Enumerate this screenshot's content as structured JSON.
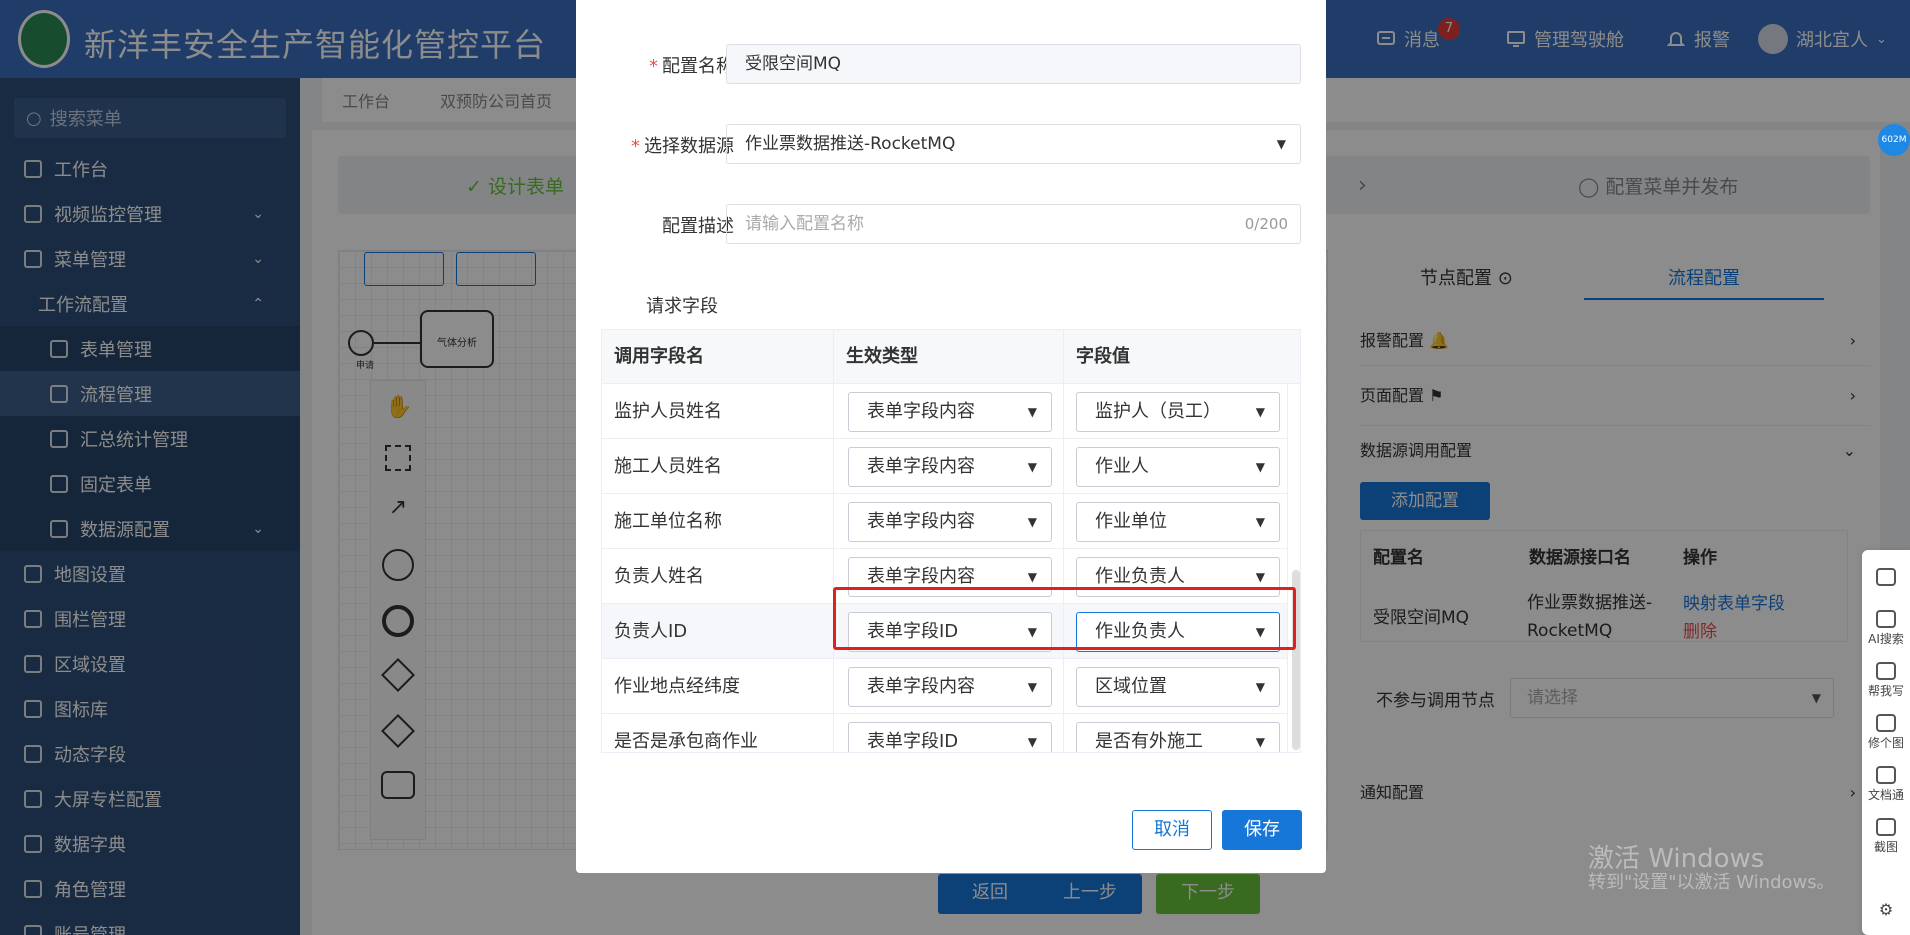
{
  "header": {
    "app_title": "新洋丰安全生产智能化管控平台",
    "messages_label": "消息",
    "messages_badge": "7",
    "cockpit_label": "管理驾驶舱",
    "alarm_label": "报警",
    "user_name": "湖北宜人"
  },
  "sidebar": {
    "search_placeholder": "搜索菜单",
    "items": [
      {
        "label": "工作台",
        "icon": "home-icon"
      },
      {
        "label": "视频监控管理",
        "icon": "camera-icon"
      },
      {
        "label": "菜单管理",
        "icon": "menu-icon"
      },
      {
        "label": "工作流配置",
        "icon": ""
      },
      {
        "label": "表单管理",
        "icon": "form-icon"
      },
      {
        "label": "流程管理",
        "icon": "flow-icon"
      },
      {
        "label": "汇总统计管理",
        "icon": "grid-icon"
      },
      {
        "label": "固定表单",
        "icon": "edit-icon"
      },
      {
        "label": "数据源配置",
        "icon": "tree-icon"
      },
      {
        "label": "地图设置",
        "icon": "map-icon"
      },
      {
        "label": "围栏管理",
        "icon": "home-icon"
      },
      {
        "label": "区域设置",
        "icon": "home-icon"
      },
      {
        "label": "图标库",
        "icon": "smile-icon"
      },
      {
        "label": "动态字段",
        "icon": "swap-icon"
      },
      {
        "label": "大屏专栏配置",
        "icon": "monitor-icon"
      },
      {
        "label": "数据字典",
        "icon": "book-icon"
      },
      {
        "label": "角色管理",
        "icon": "user-icon"
      },
      {
        "label": "账号管理",
        "icon": "user-icon"
      }
    ]
  },
  "tabs": [
    "工作台",
    "双预防公司首页"
  ],
  "steps": {
    "first": "设计表单",
    "last": "配置菜单并发布"
  },
  "canvas": {
    "start_label": "申请",
    "task_label": "气体分析"
  },
  "right_panel": {
    "tab_node": "节点配置",
    "tab_flow": "流程配置",
    "alarm_config": "报警配置",
    "page_config": "页面配置",
    "datasource_config": "数据源调用配置",
    "add_config": "添加配置",
    "cols": [
      "配置名",
      "数据源接口名",
      "操作"
    ],
    "row": {
      "name": "受限空间MQ",
      "iface": "作业票数据推送-RocketMQ",
      "map_link": "映射表单字段",
      "delete_link": "删除"
    },
    "exclude_label": "不参与调用节点",
    "exclude_placeholder": "请选择",
    "notify_config": "通知配置"
  },
  "bottom_buttons": {
    "back": "返回",
    "prev": "上一步",
    "next": "下一步"
  },
  "modal": {
    "name_label": "配置名称",
    "name_value": "受限空间MQ",
    "source_label": "选择数据源",
    "source_value": "作业票数据推送-RocketMQ",
    "desc_label": "配置描述",
    "desc_placeholder": "请输入配置名称",
    "desc_count": "0/200",
    "req_fields_label": "请求字段",
    "columns": [
      "调用字段名",
      "生效类型",
      "字段值"
    ],
    "rows": [
      {
        "name": "监护人员姓名",
        "type": "表单字段内容",
        "value": "监护人（员工）"
      },
      {
        "name": "施工人员姓名",
        "type": "表单字段内容",
        "value": "作业人"
      },
      {
        "name": "施工单位名称",
        "type": "表单字段内容",
        "value": "作业单位"
      },
      {
        "name": "负责人姓名",
        "type": "表单字段内容",
        "value": "作业负责人"
      },
      {
        "name": "负责人ID",
        "type": "表单字段ID",
        "value": "作业负责人"
      },
      {
        "name": "作业地点经纬度",
        "type": "表单字段内容",
        "value": "区域位置"
      },
      {
        "name": "是否是承包商作业",
        "type": "表单字段ID",
        "value": "是否有外施工"
      }
    ],
    "cancel": "取消",
    "save": "保存"
  },
  "watermark": {
    "line1": "激活 Windows",
    "line2": "转到\"设置\"以激活 Windows。"
  },
  "right_tools": {
    "mem": "602M",
    "ai_search": "AI搜索",
    "help_write": "帮我写",
    "fix_image": "修个图",
    "doc": "文档通",
    "screenshot": "截图"
  },
  "colors": {
    "header": "#3a6fbd",
    "sidebar": "#2f4f7a",
    "primary": "#1677d9",
    "highlight": "#e02020",
    "next_btn": "#67c23a"
  }
}
